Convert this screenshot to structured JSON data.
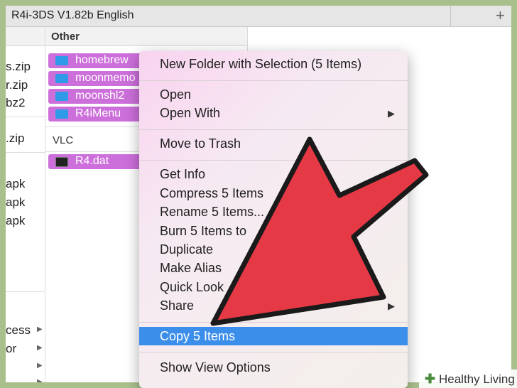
{
  "window": {
    "title": "R4i-3DS V1.82b English"
  },
  "left_column": {
    "items": [
      "s.zip",
      "r.zip",
      "bz2",
      ".zip",
      "apk",
      "apk",
      "apk",
      "cess",
      "or"
    ]
  },
  "right_column": {
    "header": "Other",
    "selected_items": [
      "homebrew",
      "moonmemo",
      "moonshl2",
      "R4iMenu"
    ],
    "vlc_label": "VLC",
    "vlc_item": "R4.dat"
  },
  "context_menu": {
    "new_folder": "New Folder with Selection (5 Items)",
    "open": "Open",
    "open_with": "Open With",
    "move_to_trash": "Move to Trash",
    "get_info": "Get Info",
    "compress": "Compress 5 Items",
    "rename": "Rename 5 Items...",
    "burn": "Burn 5 Items to",
    "duplicate": "Duplicate",
    "make_alias": "Make Alias",
    "quick_look": "Quick Look",
    "share": "Share",
    "copy": "Copy 5 Items",
    "show_view_options": "Show View Options"
  },
  "watermark": {
    "icon": "plus-cross-icon",
    "text": "Healthy Living"
  },
  "colors": {
    "selection": "#3b8eea",
    "file_highlight": "#cc6fdb",
    "arrow": "#e63946"
  }
}
